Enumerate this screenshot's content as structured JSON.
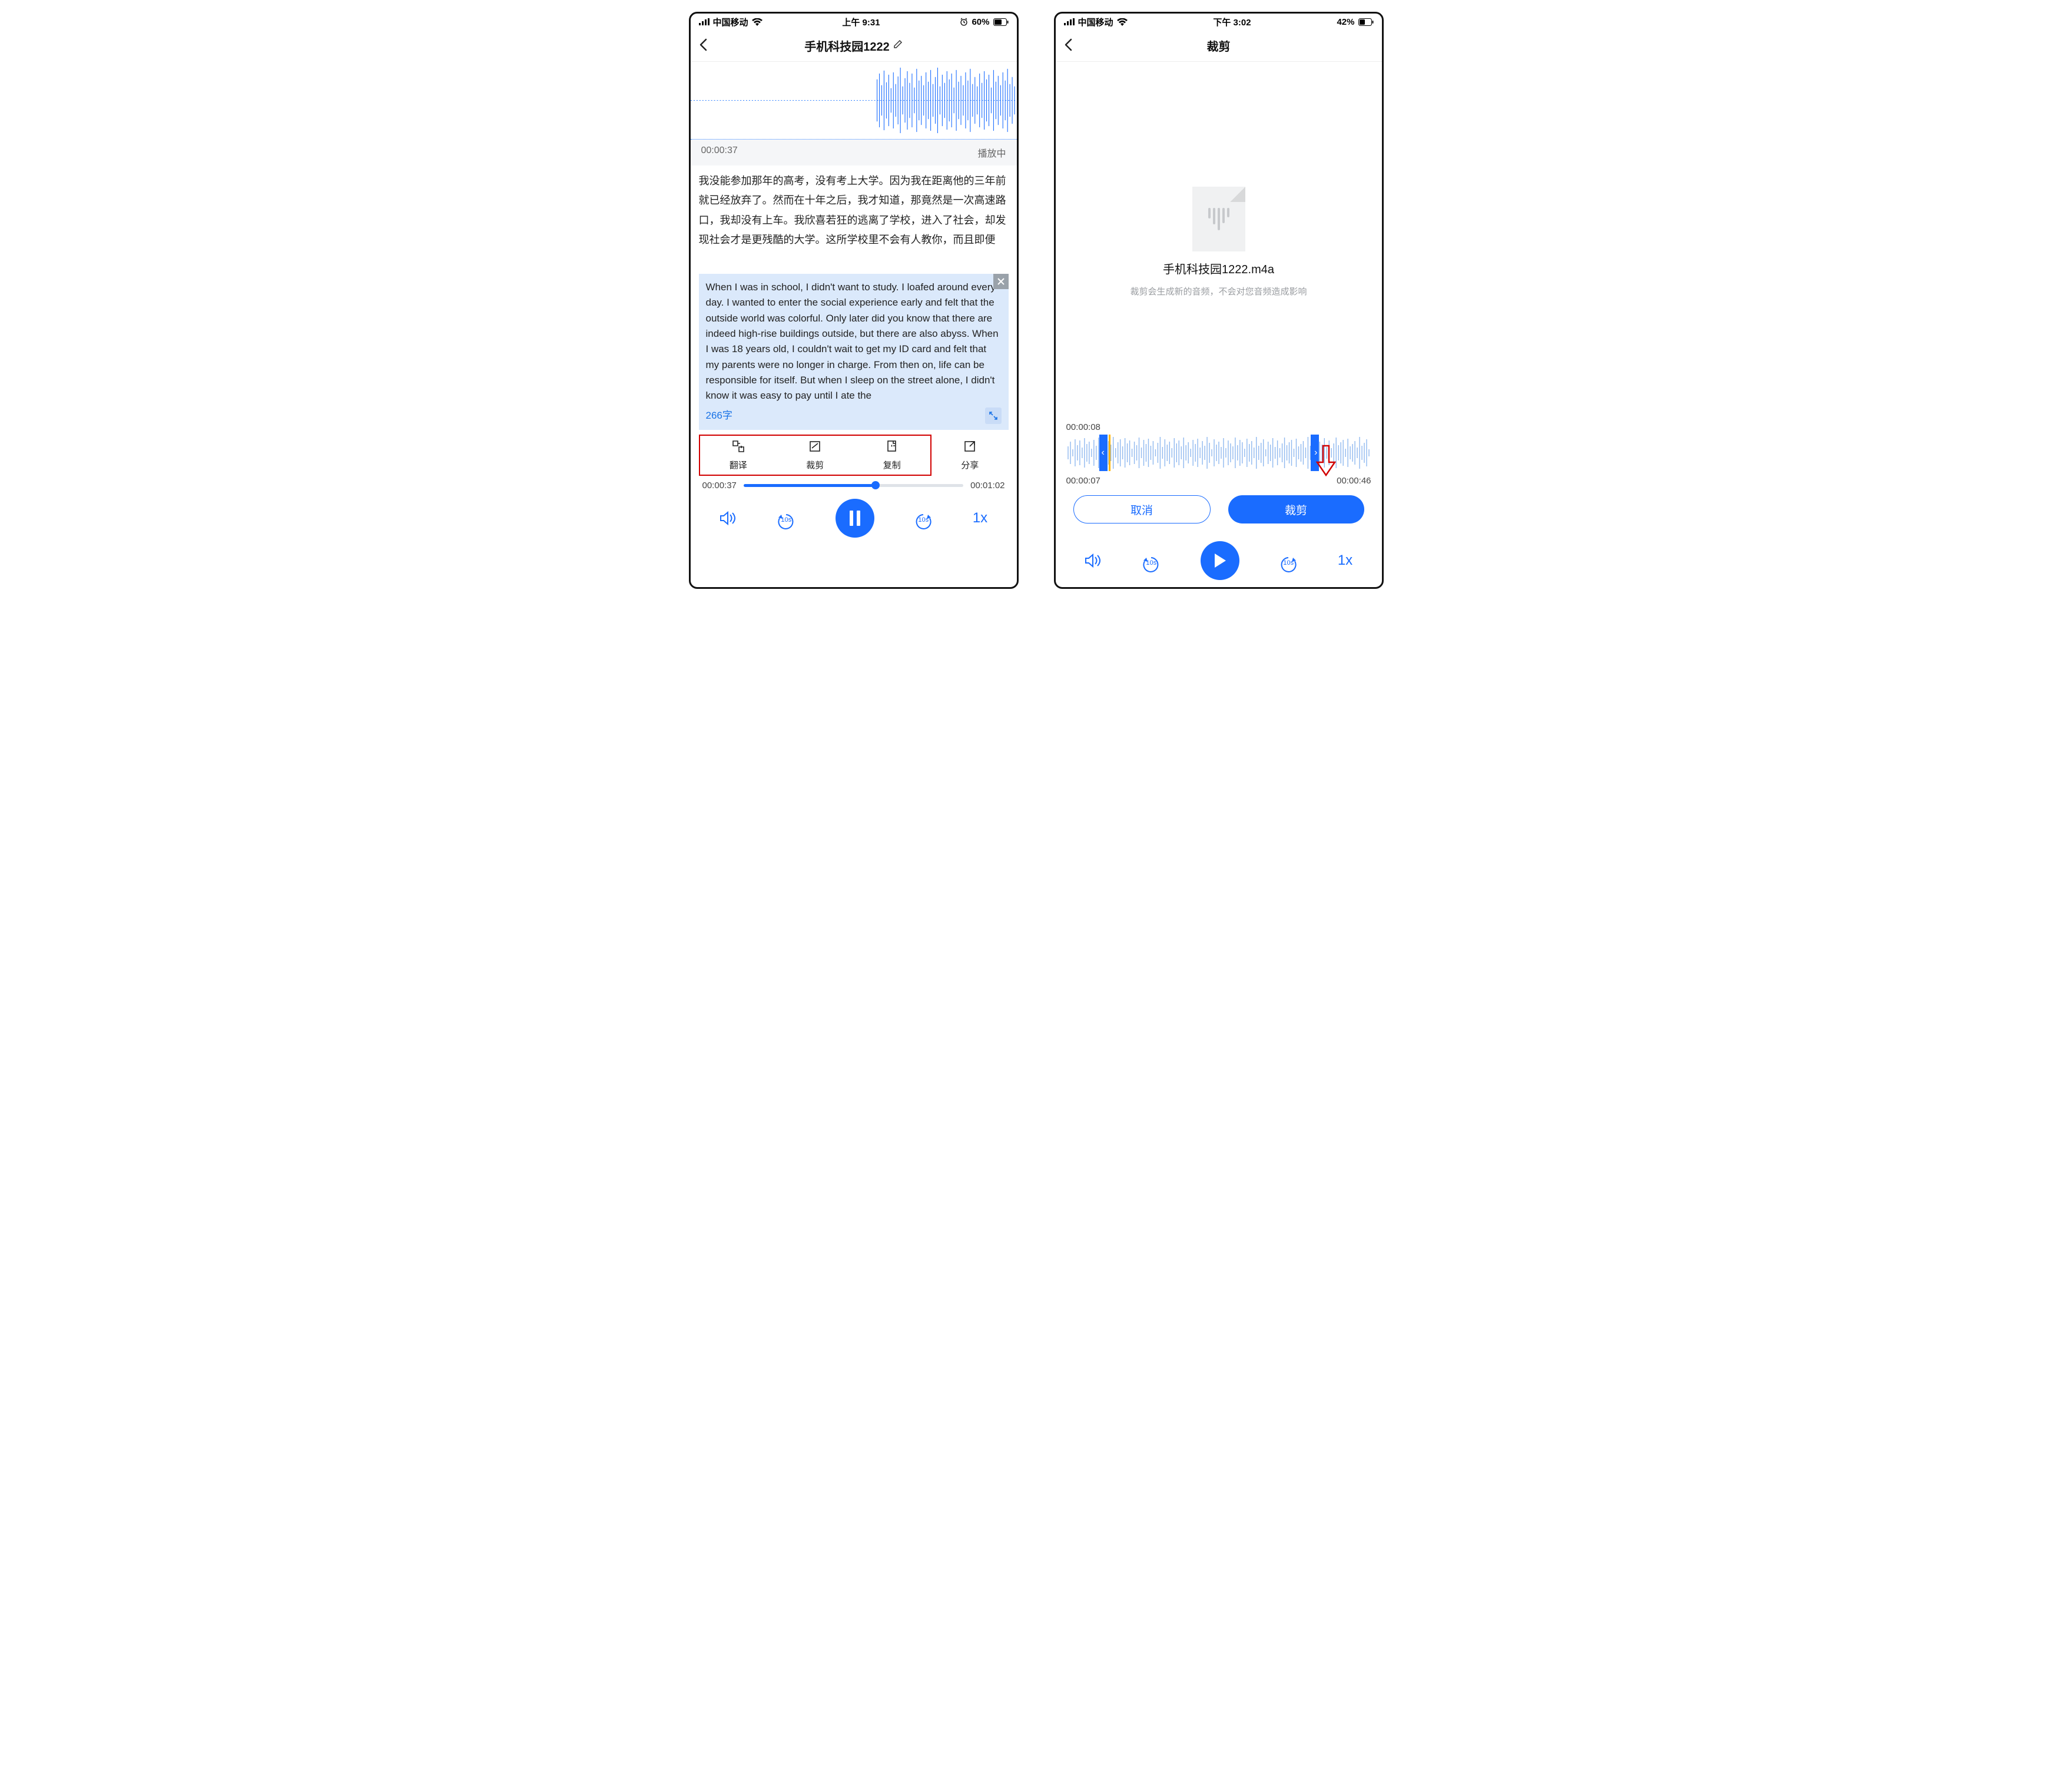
{
  "left": {
    "status": {
      "carrier": "中国移动",
      "time": "上午 9:31",
      "battery": "60%"
    },
    "title": "手机科技园1222",
    "elapsed": "00:00:37",
    "playStatus": "播放中",
    "transcript": "我没能参加那年的高考，没有考上大学。因为我在距离他的三年前就已经放弃了。然而在十年之后，我才知道，那竟然是一次高速路口，我却没有上车。我欣喜若狂的逃离了学校，进入了社会，却发现社会才是更残酷的大学。这所学校里不会有人教你，而且即便",
    "translation": "When I was in school, I didn't want to study. I loafed around every day. I wanted to enter the social experience early and felt that the outside world was colorful. Only later did you know that there are indeed high-rise buildings outside, but there are also abyss. When I was 18 years old, I couldn't wait to get my ID card and felt that my parents were no longer in charge. From then on, life can be responsible for itself. But when I sleep on the street alone, I didn't know it was easy to pay until I ate the",
    "wordCount": "266字",
    "actions": {
      "translate": "翻译",
      "trim": "裁剪",
      "copy": "复制",
      "share": "分享"
    },
    "progress": {
      "current": "00:00:37",
      "total": "00:01:02",
      "percent": 60
    },
    "speed": "1x",
    "rewind": "10s",
    "forward": "10s"
  },
  "right": {
    "status": {
      "carrier": "中国移动",
      "time": "下午 3:02",
      "battery": "42%"
    },
    "title": "裁剪",
    "fileName": "手机科技园1222.m4a",
    "hint": "裁剪会生成新的音频，不会对您音频造成影响",
    "playhead": "00:00:08",
    "selStart": "00:00:07",
    "selEnd": "00:00:46",
    "cancel": "取消",
    "confirm": "裁剪",
    "speed": "1x",
    "rewind": "10s",
    "forward": "10s"
  }
}
